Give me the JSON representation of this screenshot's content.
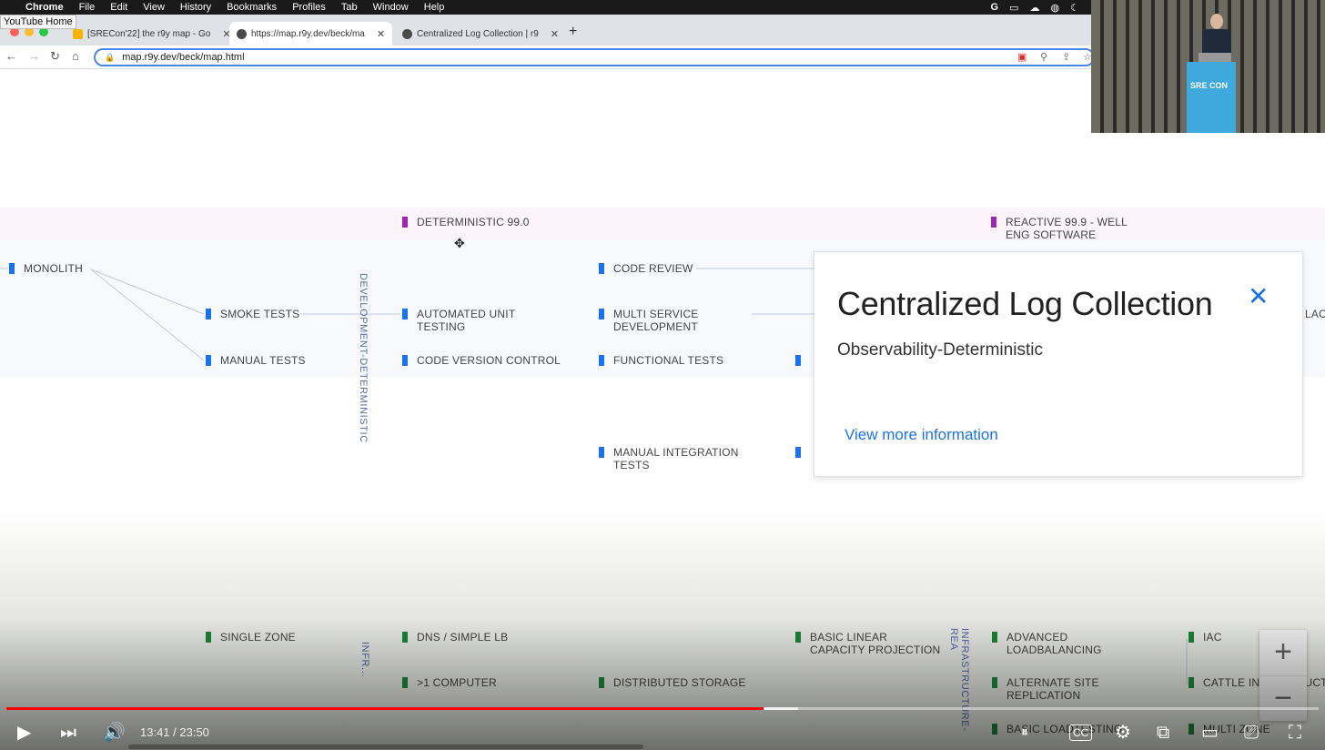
{
  "os_menu": {
    "app": "Chrome",
    "items": [
      "File",
      "Edit",
      "View",
      "History",
      "Bookmarks",
      "Profiles",
      "Tab",
      "Window",
      "Help"
    ]
  },
  "tooltip": "YouTube Home",
  "browser": {
    "tabs": [
      {
        "label": "[SRECon'22] the r9y map - Go",
        "icon": "docs-icon"
      },
      {
        "label": "https://map.r9y.dev/beck/ma",
        "icon": "globe-icon"
      },
      {
        "label": "Centralized Log Collection | r9",
        "icon": "globe-icon"
      }
    ],
    "url": "map.r9y.dev/beck/map.html"
  },
  "map": {
    "bands": [
      {
        "label": "DETERMINISTIC 99.0",
        "color": "#9c27b0"
      },
      {
        "label": "REACTIVE 99.9 - WELL ENG SOFTWARE",
        "color": "#9c27b0"
      }
    ],
    "development": [
      {
        "label": "MONOLITH"
      },
      {
        "label": "SMOKE TESTS"
      },
      {
        "label": "MANUAL TESTS"
      },
      {
        "label": "AUTOMATED UNIT TESTING"
      },
      {
        "label": "CODE VERSION CONTROL"
      },
      {
        "label": "CODE REVIEW"
      },
      {
        "label": "MULTI SERVICE DEVELOPMENT"
      },
      {
        "label": "FUNCTIONAL TESTS"
      },
      {
        "label": "MANUAL INTEGRATION TESTS"
      }
    ],
    "vertical_labels": {
      "dev": "DEVELOPMENT-DETERMINISTIC",
      "infra_short": "INFR...",
      "infra": "INFRASTRUCTURE-REA"
    },
    "infrastructure": [
      {
        "label": "SINGLE ZONE"
      },
      {
        "label": "DNS / SIMPLE LB"
      },
      {
        "label": ">1 COMPUTER"
      },
      {
        "label": "DISTRIBUTED STORAGE"
      },
      {
        "label": "BASIC LINEAR CAPACITY PROJECTION"
      },
      {
        "label": "ADVANCED LOADBALANCING"
      },
      {
        "label": "ALTERNATE SITE REPLICATION"
      },
      {
        "label": "BASIC LOADTESTING"
      },
      {
        "label": "IAC"
      },
      {
        "label": "CATTLE INFRASTRUCTURE"
      },
      {
        "label": "MULTI ZONE"
      }
    ],
    "edge_label": "LAC"
  },
  "card": {
    "title": "Centralized Log Collection",
    "subtitle": "Observability-Deterministic",
    "link": "View more information"
  },
  "webcam": {
    "podium_text": "SRE CON"
  },
  "player": {
    "time": "13:41 / 23:50",
    "progress": 0.577,
    "buffered": 0.603
  }
}
